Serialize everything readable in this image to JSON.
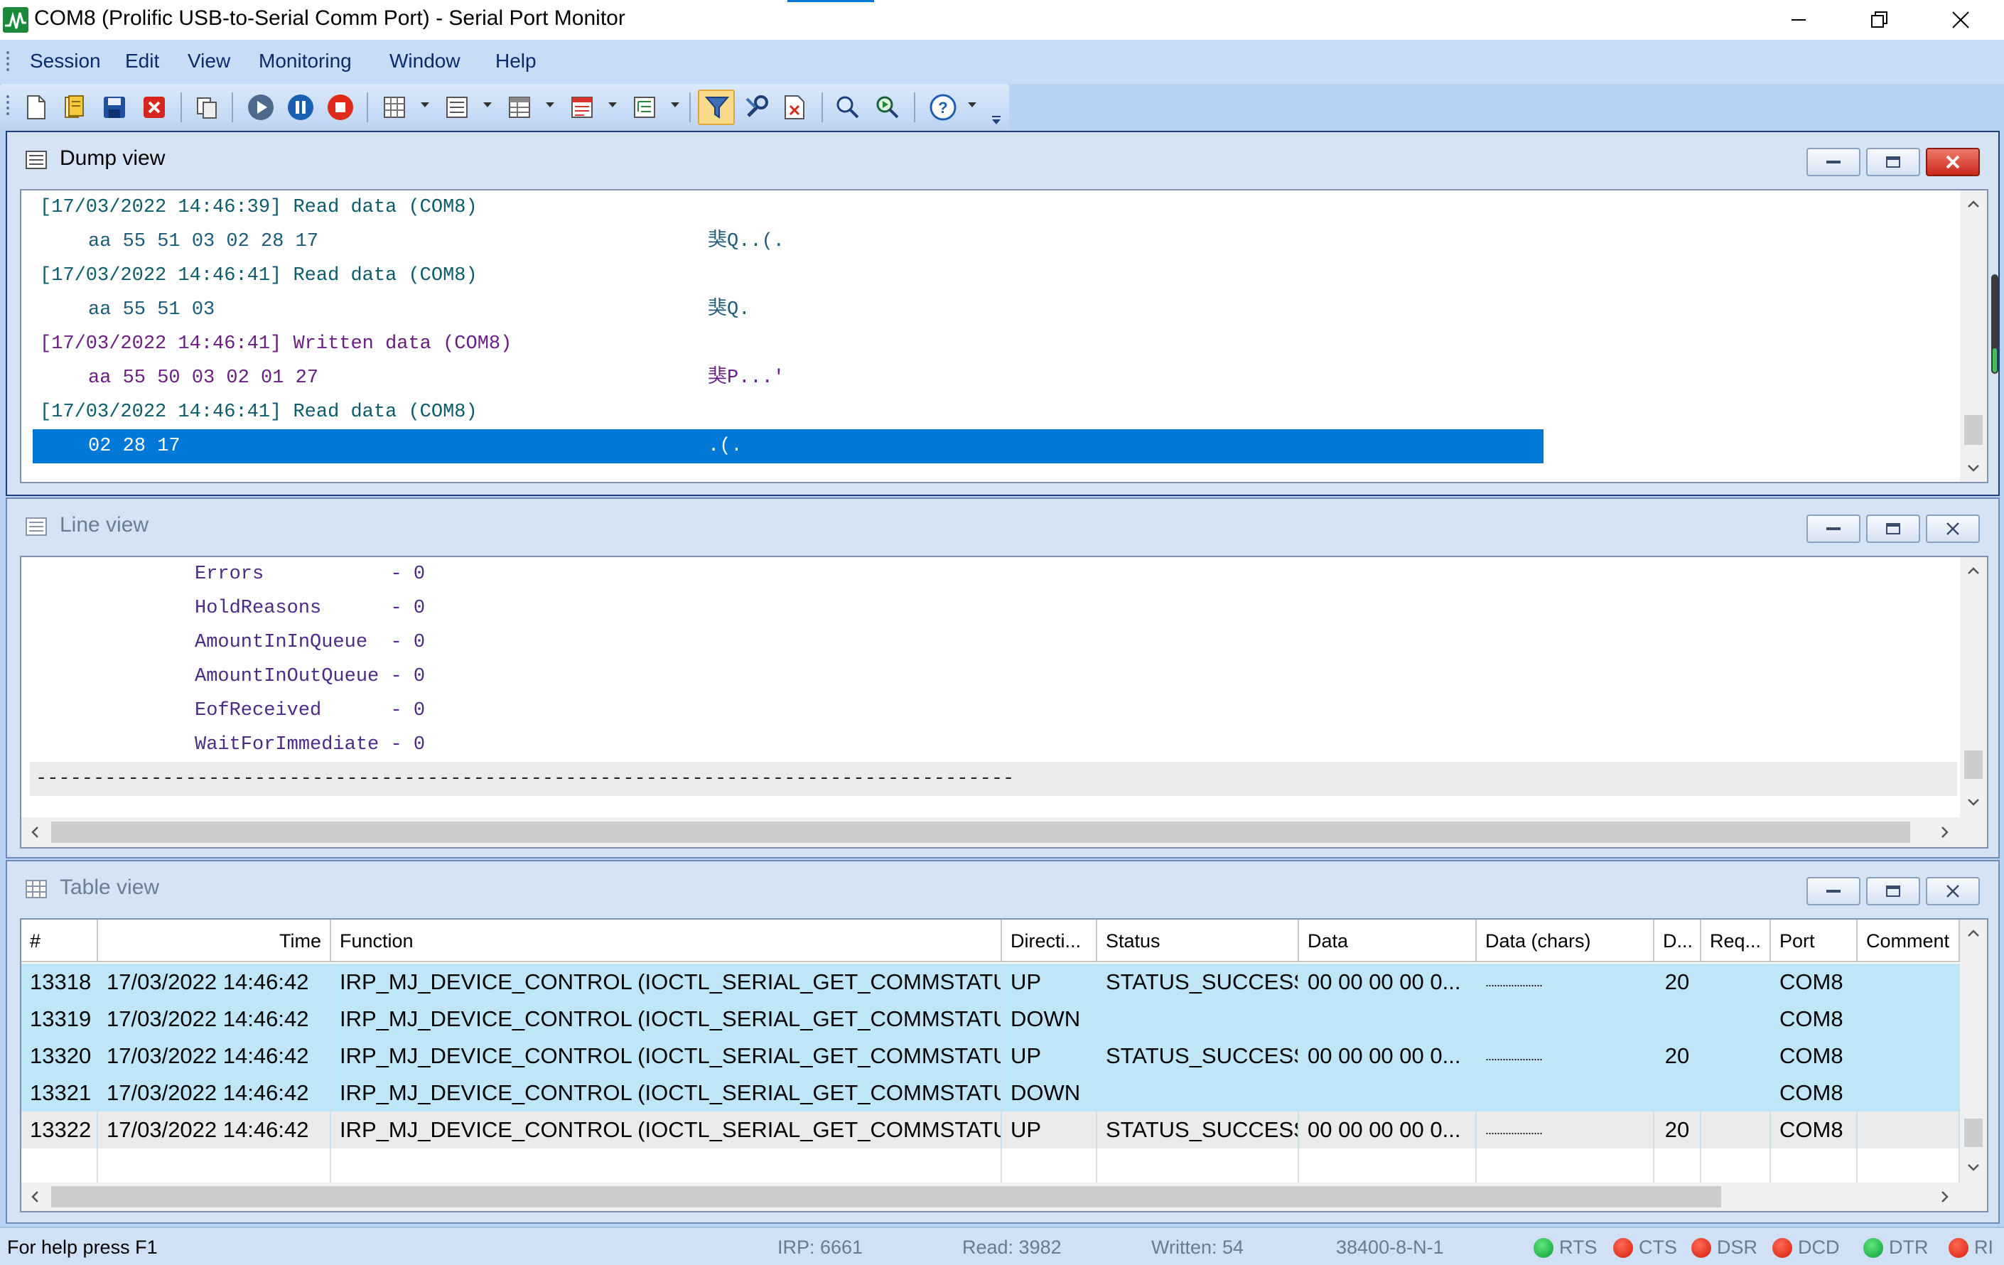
{
  "window": {
    "title": "COM8 (Prolific USB-to-Serial Comm Port) - Serial Port Monitor",
    "app_icon": "activity-chart-icon"
  },
  "menu": [
    "Session",
    "Edit",
    "View",
    "Monitoring",
    "Window",
    "Help"
  ],
  "toolbar": {
    "icons": [
      "new-session-icon",
      "open-session-icon",
      "save-icon",
      "close-session-icon",
      "copy-icon",
      "start-icon",
      "pause-icon",
      "stop-icon",
      "grid-view-icon",
      "list-view-icon",
      "table-view-icon",
      "dump-view-icon",
      "tree-view-icon",
      "filter-icon",
      "settings-icon",
      "clear-icon",
      "find-icon",
      "find-next-icon",
      "help-icon",
      "customize-icon"
    ],
    "active_icon": "filter-icon"
  },
  "dump_view": {
    "title": "Dump view",
    "entries": [
      {
        "kind": "read",
        "header": "[17/03/2022 14:46:39] Read data (COM8)",
        "hex": "aa 55 51 03 02 28 17",
        "chars": "猆Q..(."
      },
      {
        "kind": "read",
        "header": "[17/03/2022 14:46:41] Read data (COM8)",
        "hex": "aa 55 51 03",
        "chars": "猆Q."
      },
      {
        "kind": "write",
        "header": "[17/03/2022 14:46:41] Written data (COM8)",
        "hex": "aa 55 50 03 02 01 27",
        "chars": "猆P...'"
      },
      {
        "kind": "read",
        "header": "[17/03/2022 14:46:41] Read data (COM8)",
        "hex": "02 28 17",
        "chars": ".(."
      }
    ]
  },
  "line_view": {
    "title": "Line view",
    "items": [
      "Errors           - 0",
      "HoldReasons      - 0",
      "AmountInInQueue  - 0",
      "AmountInOutQueue - 0",
      "EofReceived      - 0",
      "WaitForImmediate - 0"
    ],
    "separator": "-------------------------------------------------------------------------------------"
  },
  "table_view": {
    "title": "Table view",
    "columns": [
      "#",
      "Time",
      "Function",
      "Directi...",
      "Status",
      "Data",
      "Data (chars)",
      "D...",
      "Req...",
      "Port",
      "Comment"
    ],
    "rows": [
      [
        "13318",
        "17/03/2022 14:46:42",
        "IRP_MJ_DEVICE_CONTROL (IOCTL_SERIAL_GET_COMMSTATUS)",
        "UP",
        "STATUS_SUCCESS",
        "00 00 00 00 0...",
        "....................",
        "20",
        "",
        "COM8",
        ""
      ],
      [
        "13319",
        "17/03/2022 14:46:42",
        "IRP_MJ_DEVICE_CONTROL (IOCTL_SERIAL_GET_COMMSTATUS)",
        "DOWN",
        "",
        "",
        "",
        "",
        "",
        "COM8",
        ""
      ],
      [
        "13320",
        "17/03/2022 14:46:42",
        "IRP_MJ_DEVICE_CONTROL (IOCTL_SERIAL_GET_COMMSTATUS)",
        "UP",
        "STATUS_SUCCESS",
        "00 00 00 00 0...",
        "....................",
        "20",
        "",
        "COM8",
        ""
      ],
      [
        "13321",
        "17/03/2022 14:46:42",
        "IRP_MJ_DEVICE_CONTROL (IOCTL_SERIAL_GET_COMMSTATUS)",
        "DOWN",
        "",
        "",
        "",
        "",
        "",
        "COM8",
        ""
      ],
      [
        "13322",
        "17/03/2022 14:46:42",
        "IRP_MJ_DEVICE_CONTROL (IOCTL_SERIAL_GET_COMMSTATUS)",
        "UP",
        "STATUS_SUCCESS",
        "00 00 00 00 0...",
        "....................",
        "20",
        "",
        "COM8",
        ""
      ]
    ]
  },
  "status_bar": {
    "help": "For help press F1",
    "irp": "IRP: 6661",
    "read": "Read: 3982",
    "written": "Written: 54",
    "port_settings": "38400-8-N-1",
    "lines": [
      {
        "name": "RTS",
        "state": "green"
      },
      {
        "name": "CTS",
        "state": "red"
      },
      {
        "name": "DSR",
        "state": "red"
      },
      {
        "name": "DCD",
        "state": "red"
      },
      {
        "name": "DTR",
        "state": "green"
      },
      {
        "name": "RI",
        "state": "red"
      }
    ]
  }
}
